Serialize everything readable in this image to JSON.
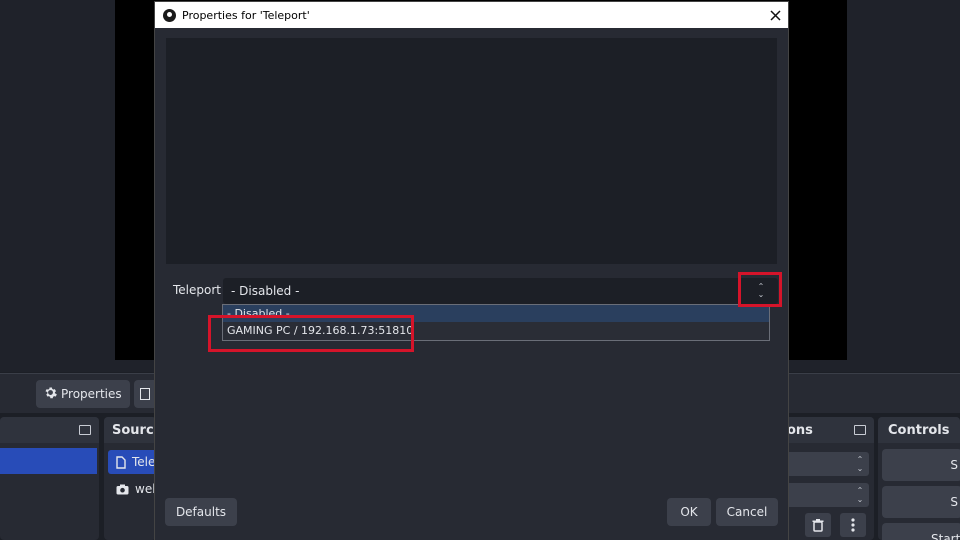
{
  "dialog": {
    "title": "Properties for 'Teleport'",
    "property_label": "Teleport",
    "combo_value": "- Disabled -",
    "dropdown_options": [
      "- Disabled -",
      "GAMING PC / 192.168.1.73:51810"
    ],
    "defaults_label": "Defaults",
    "ok_label": "OK",
    "cancel_label": "Cancel"
  },
  "toolbar": {
    "properties_label": "Properties"
  },
  "docks": {
    "sources_title": "Source",
    "sources": [
      {
        "name": "Tele",
        "icon": "file-icon"
      },
      {
        "name": "web",
        "icon": "camera-icon"
      }
    ],
    "transitions_title": "ons",
    "controls_title": "Controls",
    "controls_buttons": [
      "S",
      "S",
      "Start V"
    ]
  },
  "colors": {
    "highlight": "#d5142a",
    "selection": "#284cb8"
  }
}
